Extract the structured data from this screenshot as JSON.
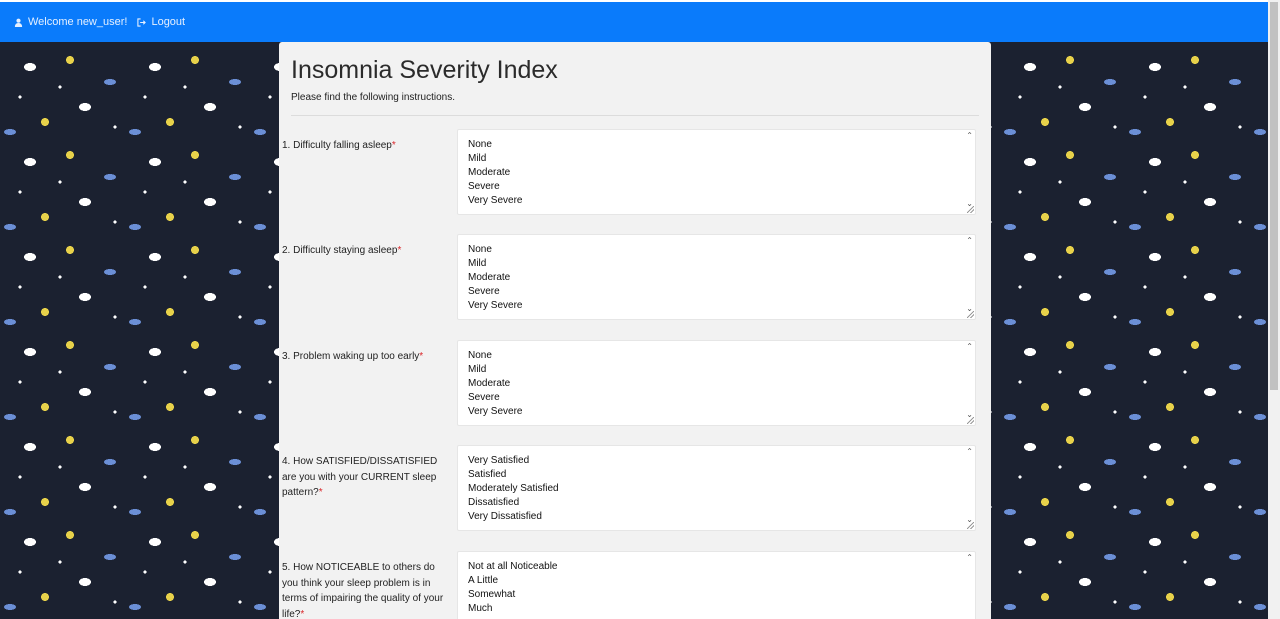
{
  "navbar": {
    "welcome": "Welcome new_user!",
    "logout": "Logout",
    "accent": "#0a7bfb"
  },
  "form": {
    "title": "Insomnia Severity Index",
    "instructions": "Please find the following instructions.",
    "required_marker": "*",
    "questions": [
      {
        "label": "1. Difficulty falling asleep",
        "options": [
          "None",
          "Mild",
          "Moderate",
          "Severe",
          "Very Severe"
        ]
      },
      {
        "label": "2. Difficulty staying asleep",
        "options": [
          "None",
          "Mild",
          "Moderate",
          "Severe",
          "Very Severe"
        ]
      },
      {
        "label": "3. Problem waking up too early",
        "options": [
          "None",
          "Mild",
          "Moderate",
          "Severe",
          "Very Severe"
        ]
      },
      {
        "label": "4. How SATISFIED/DISSATISFIED are you with your CURRENT sleep pattern?",
        "options": [
          "Very Satisfied",
          "Satisfied",
          "Moderately Satisfied",
          "Dissatisfied",
          "Very Dissatisfied"
        ]
      },
      {
        "label": "5. How NOTICEABLE to others do you think your sleep problem is in terms of impairing the quality of your life?",
        "options": [
          "Not at all Noticeable",
          "A Little",
          "Somewhat",
          "Much"
        ]
      }
    ]
  },
  "icons": {
    "user": "user-icon",
    "logout": "logout-icon"
  }
}
